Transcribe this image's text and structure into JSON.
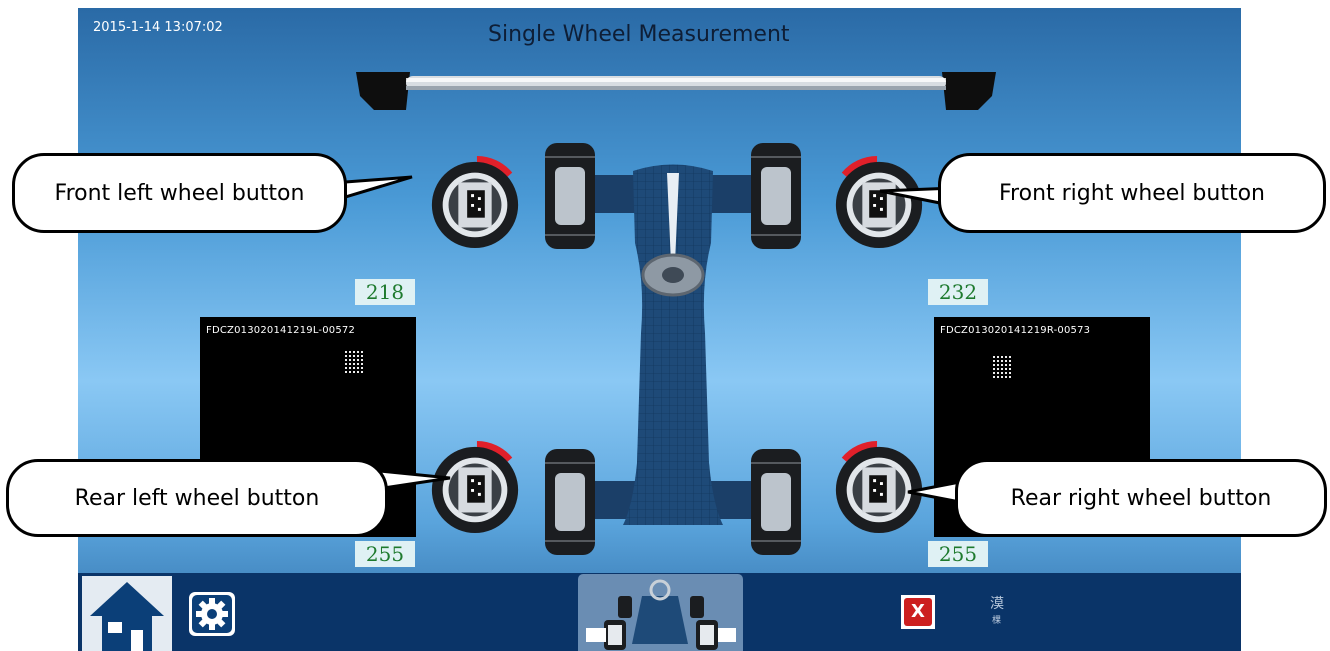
{
  "header": {
    "datetime": "2015-1-14 13:07:02",
    "title": "Single Wheel Measurement"
  },
  "readings": {
    "front_left": "218",
    "front_right": "232",
    "rear_left": "255",
    "rear_right": "255"
  },
  "target_panels": {
    "left_code": "FDCZ013020141219L-00572",
    "right_code": "FDCZ013020141219R-00573"
  },
  "callouts": {
    "front_left": "Front left wheel button",
    "front_right": "Front right wheel button",
    "rear_left": "Rear left wheel button",
    "rear_right": "Rear right wheel button"
  },
  "taskbar": {
    "close_label": "X",
    "side_text_1": "漠",
    "side_text_2": "棵"
  },
  "icons": {
    "home": "home-icon",
    "settings": "gear-icon",
    "vehicle": "vehicle-thumbnail-icon",
    "close": "close-icon"
  },
  "colors": {
    "counter_text": "#1e7a2e",
    "counter_bg": "#dff1f4",
    "taskbar_bg": "#0a3468",
    "close_red": "#cc1f1f"
  }
}
